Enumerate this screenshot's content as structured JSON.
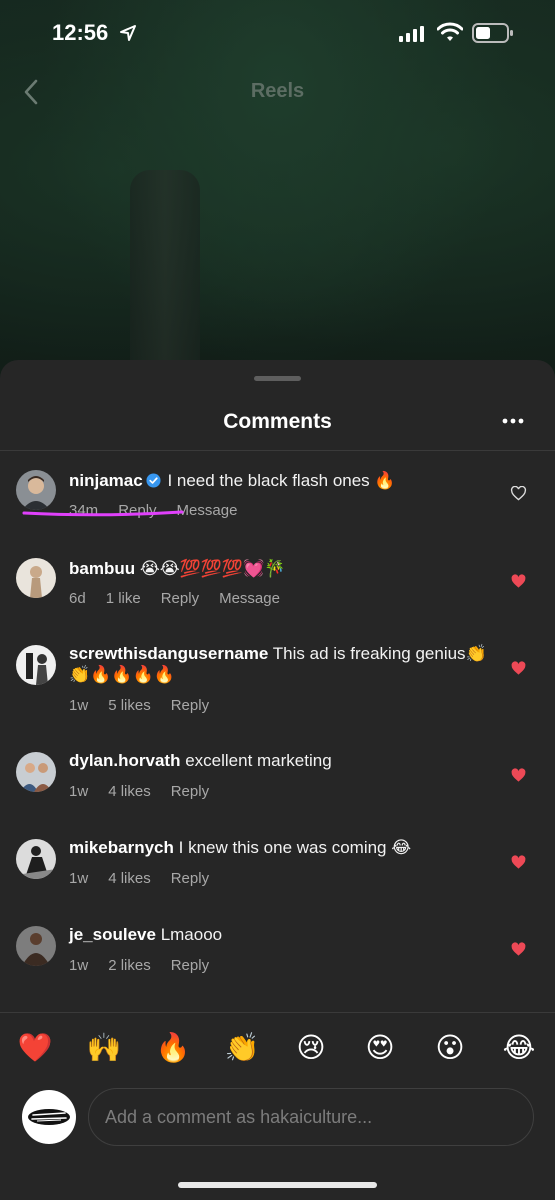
{
  "status_bar": {
    "time": "12:56"
  },
  "header": {
    "title": "Reels"
  },
  "sheet": {
    "title": "Comments",
    "comments": [
      {
        "username": "ninjamac",
        "verified": true,
        "text": "I need the black flash ones 🔥",
        "time": "34m",
        "likes": "",
        "reply": "Reply",
        "message": "Message",
        "liked": false
      },
      {
        "username": "bambuu",
        "text": "😭😭💯💯💯💓🎋",
        "time": "6d",
        "likes": "1 like",
        "reply": "Reply",
        "message": "Message",
        "liked": true
      },
      {
        "username": "screwthisdangusername",
        "text": "This ad is freaking genius👏👏🔥🔥🔥🔥",
        "time": "1w",
        "likes": "5 likes",
        "reply": "Reply",
        "liked": true
      },
      {
        "username": "dylan.horvath",
        "text": "excellent marketing",
        "time": "1w",
        "likes": "4 likes",
        "reply": "Reply",
        "liked": true
      },
      {
        "username": "mikebarnych",
        "text": "I knew this one was coming 😂",
        "time": "1w",
        "likes": "4 likes",
        "reply": "Reply",
        "liked": true
      },
      {
        "username": "je_souleve",
        "text": "Lmaooo",
        "time": "1w",
        "likes": "2 likes",
        "reply": "Reply",
        "liked": true
      }
    ],
    "emoji_bar": [
      "❤️",
      "🙌",
      "🔥",
      "👏",
      "😢",
      "😍",
      "😮",
      "😂"
    ],
    "input": {
      "placeholder": "Add a comment as hakaiculture..."
    }
  },
  "colors": {
    "heart": "#ed4956",
    "underline": "#e040fb",
    "sheet_bg": "#262626"
  }
}
